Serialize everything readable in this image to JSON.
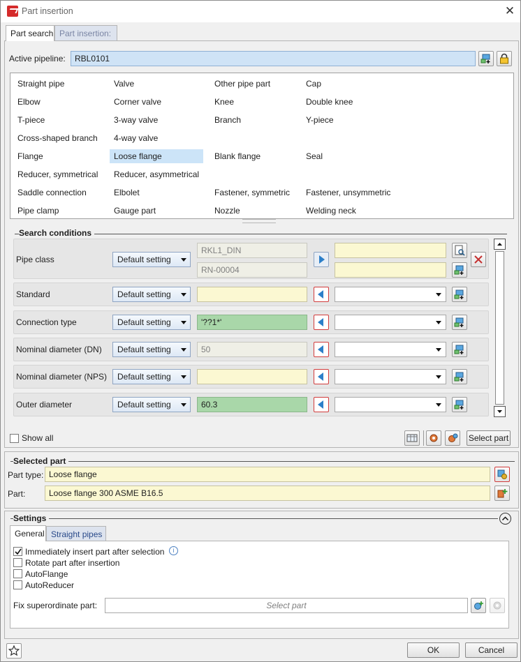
{
  "window": {
    "title": "Part insertion",
    "close_glyph": "✕"
  },
  "tabs": [
    {
      "label": "Part search",
      "active": true
    },
    {
      "label": "Part insertion:",
      "active": false
    }
  ],
  "active_pipeline": {
    "label": "Active pipeline:",
    "value": "RBL0101"
  },
  "part_types": {
    "col1": [
      "Straight pipe",
      "Elbow",
      "T-piece",
      "Cross-shaped branch",
      "Flange",
      "Reducer, symmetrical",
      "Saddle connection",
      "Pipe clamp"
    ],
    "col2": [
      "Valve",
      "Corner valve",
      "3-way valve",
      "4-way valve",
      "Loose flange",
      "Reducer, asymmetrical",
      "Elbolet",
      "Gauge part"
    ],
    "col3": [
      "Other pipe part",
      "Knee",
      "Branch",
      "",
      "Blank flange",
      "",
      "Fastener, symmetric",
      "Nozzle"
    ],
    "col4": [
      "Cap",
      "Double knee",
      "Y-piece",
      "",
      "Seal",
      "",
      "Fastener, unsymmetric",
      "Welding neck"
    ],
    "selected": "Loose flange"
  },
  "search_conditions": {
    "header": "Search conditions",
    "rows": [
      {
        "name": "Pipe class",
        "setting": "Default setting",
        "value1": "RKL1_DIN",
        "value2": "RN-00004"
      },
      {
        "name": "Standard",
        "setting": "Default setting",
        "value": ""
      },
      {
        "name": "Connection type",
        "setting": "Default setting",
        "value": "'??1*'"
      },
      {
        "name": "Nominal diameter (DN)",
        "setting": "Default setting",
        "value": "50"
      },
      {
        "name": "Nominal diameter (NPS)",
        "setting": "Default setting",
        "value": ""
      },
      {
        "name": "Outer diameter",
        "setting": "Default setting",
        "value": "60.3"
      }
    ],
    "show_all_label": "Show all",
    "select_part_label": "Select part"
  },
  "selected_part": {
    "header": "Selected part",
    "part_type_label": "Part type:",
    "part_type_value": "Loose flange",
    "part_label": "Part:",
    "part_value": "Loose flange 300 ASME B16.5"
  },
  "settings": {
    "header": "Settings",
    "tabs": [
      {
        "label": "General",
        "active": true
      },
      {
        "label": "Straight pipes",
        "active": false
      }
    ],
    "options": [
      {
        "label": "Immediately insert part after selection",
        "checked": true
      },
      {
        "label": "Rotate part after insertion",
        "checked": false
      },
      {
        "label": "AutoFlange",
        "checked": false
      },
      {
        "label": "AutoReducer",
        "checked": false
      }
    ],
    "fix_label": "Fix superordinate part:",
    "fix_placeholder": "Select part"
  },
  "footer": {
    "ok": "OK",
    "cancel": "Cancel"
  },
  "colors": {
    "yellow_field": "#fbf8d2",
    "green_field": "#a9d7a9",
    "blue_field": "#cfe3f6",
    "selection": "#cce4f8"
  }
}
